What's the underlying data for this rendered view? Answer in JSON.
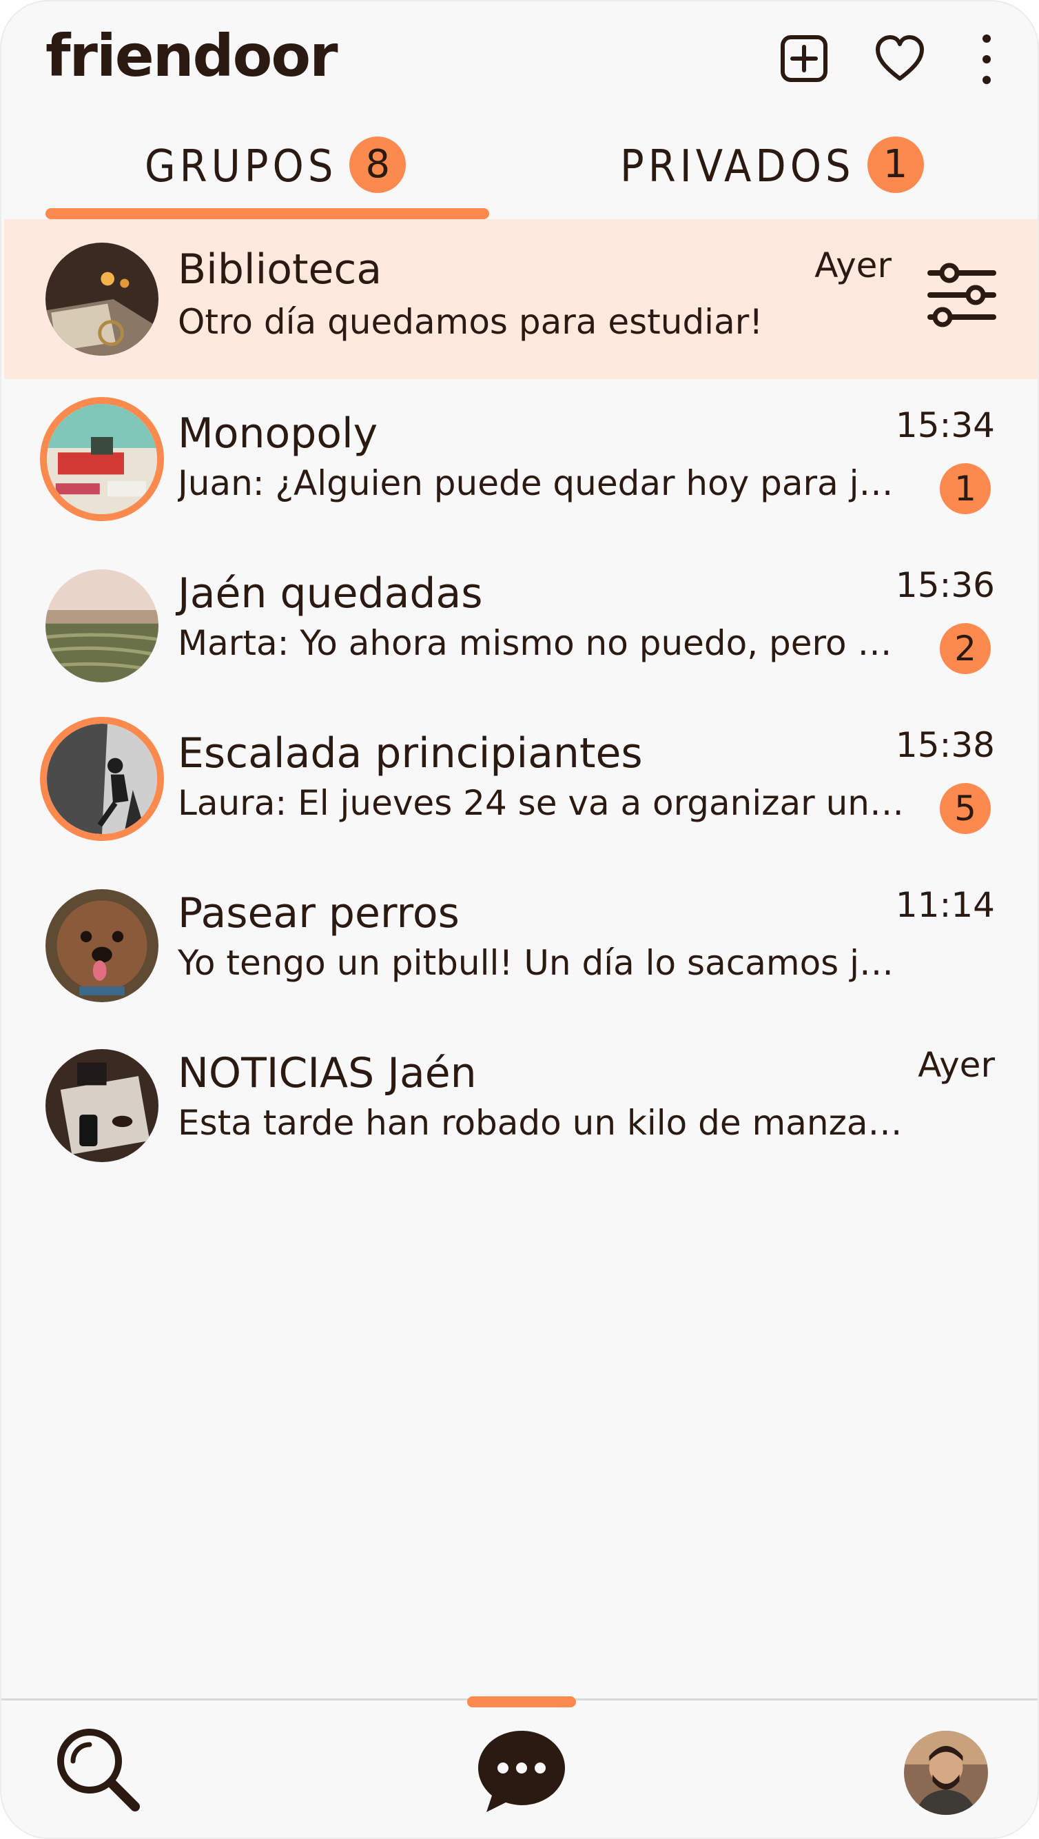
{
  "app": {
    "title": "friendoor"
  },
  "header": {
    "icons": [
      "add-square-icon",
      "heart-icon",
      "more-vertical-icon"
    ]
  },
  "tabs": [
    {
      "label": "GRUPOS",
      "badge": "8",
      "active": true
    },
    {
      "label": "PRIVADOS",
      "badge": "1",
      "active": false
    }
  ],
  "chats": [
    {
      "name": "Biblioteca",
      "message": "Otro día quedamos para estudiar!",
      "time": "Ayer",
      "unread": "",
      "selected": true,
      "ring": false
    },
    {
      "name": "Monopoly",
      "message": "Juan: ¿Alguien puede quedar hoy para ju...",
      "time": "15:34",
      "unread": "1",
      "selected": false,
      "ring": true
    },
    {
      "name": "Jaén quedadas",
      "message": "Marta: Yo ahora mismo no puedo, pero po...",
      "time": "15:36",
      "unread": "2",
      "selected": false,
      "ring": false
    },
    {
      "name": "Escalada principiantes",
      "message": "Laura: El jueves 24 se va a organizar un co...",
      "time": "15:38",
      "unread": "5",
      "selected": false,
      "ring": true
    },
    {
      "name": "Pasear perros",
      "message": "Yo tengo un pitbull! Un día lo sacamos jun...",
      "time": "11:14",
      "unread": "",
      "selected": false,
      "ring": false
    },
    {
      "name": "NOTICIAS Jaén",
      "message": "Esta tarde han robado un kilo de manzana...",
      "time": "Ayer",
      "unread": "",
      "selected": false,
      "ring": false
    }
  ],
  "bottom_nav": {
    "items": [
      "search-icon",
      "chat-bubble-icon",
      "profile-avatar"
    ],
    "active": "chat-bubble-icon"
  },
  "colors": {
    "accent": "#fc8a4f",
    "selected_row": "#fde9dd",
    "text": "#2b1a12",
    "background": "#f9f8f8"
  }
}
